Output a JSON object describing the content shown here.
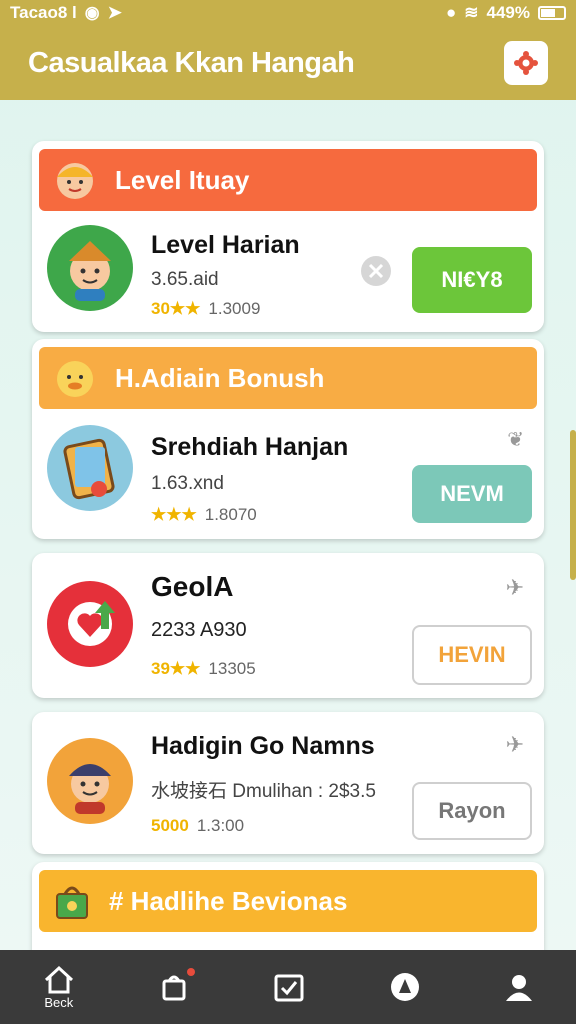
{
  "status": {
    "left_text": "Tacao8 l",
    "right_text": "449%"
  },
  "app": {
    "title": "Casualkaa Kkan Hangah"
  },
  "cards": [
    {
      "header": "Level Ituay",
      "title": "Level Harian",
      "subtitle": "3.65.aid",
      "points": "30",
      "stars": "★★",
      "count": "1.3009",
      "button": "NI€Y8"
    },
    {
      "header": "H.Adiain Bonush",
      "title": "Srehdiah Hanjan",
      "subtitle": "1.63.xnd",
      "points": "",
      "stars": "★★★",
      "count": "1.8070",
      "button": "NEVM"
    },
    {
      "title": "GeolA",
      "subtitle": "2233 A930",
      "points": "39",
      "stars": "★★",
      "count": "13305",
      "button": "HEVIN"
    },
    {
      "title": "Hadigin Go Namns",
      "subtitle": "水坡接石 Dmulihan : 2$3.5",
      "points": "5000",
      "stars": "",
      "count": "1.3:00",
      "button": "Rayon"
    },
    {
      "header": "# Hadlihe Bevionas"
    }
  ],
  "nav": {
    "back_label": "Beck"
  },
  "colors": {
    "accent": "#c6b04b",
    "orange": "#f66a3e",
    "amber": "#f8ac44",
    "yellow": "#f9b52e",
    "green": "#6cc63a",
    "teal": "#7cc8b8"
  }
}
